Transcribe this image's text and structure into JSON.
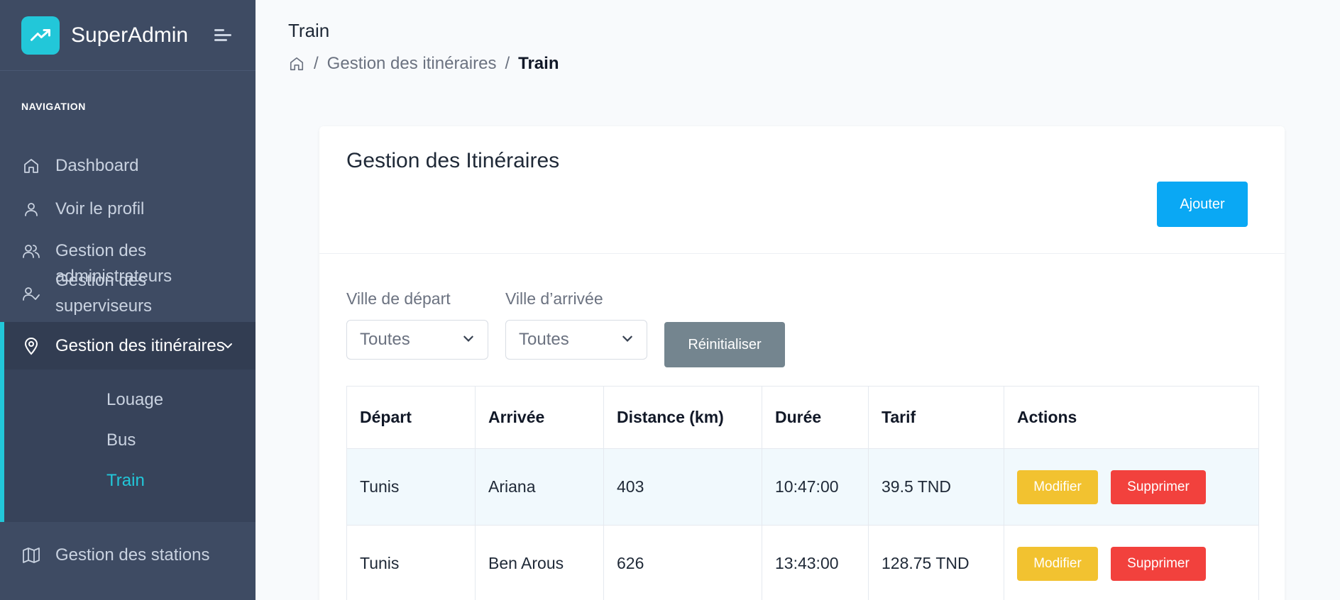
{
  "app": {
    "name": "SuperAdmin",
    "accent": "#22c7d9",
    "logo_icon": "trending-up-icon",
    "menu_icon": "menu-toggle-icon"
  },
  "sidebar": {
    "caption": "NAVIGATION",
    "items": [
      {
        "label": "Dashboard",
        "icon": "home-icon"
      },
      {
        "label": "Voir le profil",
        "icon": "user-icon"
      },
      {
        "label": "Gestion des administrateurs",
        "icon": "users-icon"
      },
      {
        "label": "Gestion des superviseurs",
        "icon": "user-check-icon"
      },
      {
        "label": "Gestion des itinéraires",
        "icon": "map-pin-icon",
        "active": true
      },
      {
        "label": "Gestion des stations",
        "icon": "map-icon"
      }
    ],
    "sub_items": [
      {
        "label": "Louage"
      },
      {
        "label": "Bus"
      },
      {
        "label": "Train",
        "current": true
      }
    ]
  },
  "page": {
    "title": "Train",
    "breadcrumb": [
      "Gestion des itinéraires",
      "Train"
    ]
  },
  "card": {
    "title": "Gestion des Itinéraires",
    "add_label": "Ajouter"
  },
  "filters": {
    "departure_label": "Ville de départ",
    "departure_value": "Toutes",
    "arrival_label": "Ville d’arrivée",
    "arrival_value": "Toutes",
    "reset_label": "Réinitialiser"
  },
  "table": {
    "columns": [
      "Départ",
      "Arrivée",
      "Distance (km)",
      "Durée",
      "Tarif",
      "Actions"
    ],
    "rows": [
      {
        "depart": "Tunis",
        "arrivee": "Ariana",
        "distance": "403",
        "duree": "10:47:00",
        "tarif": "39.5 TND"
      },
      {
        "depart": "Tunis",
        "arrivee": "Ben Arous",
        "distance": "626",
        "duree": "13:43:00",
        "tarif": "128.75 TND"
      }
    ],
    "edit_label": "Modifier",
    "delete_label": "Supprimer"
  },
  "colors": {
    "sidebar_bg": "#3e4b63",
    "primary": "#0aa8f4",
    "warning": "#f2c230",
    "danger": "#f2413d",
    "secondary": "#74858f"
  }
}
